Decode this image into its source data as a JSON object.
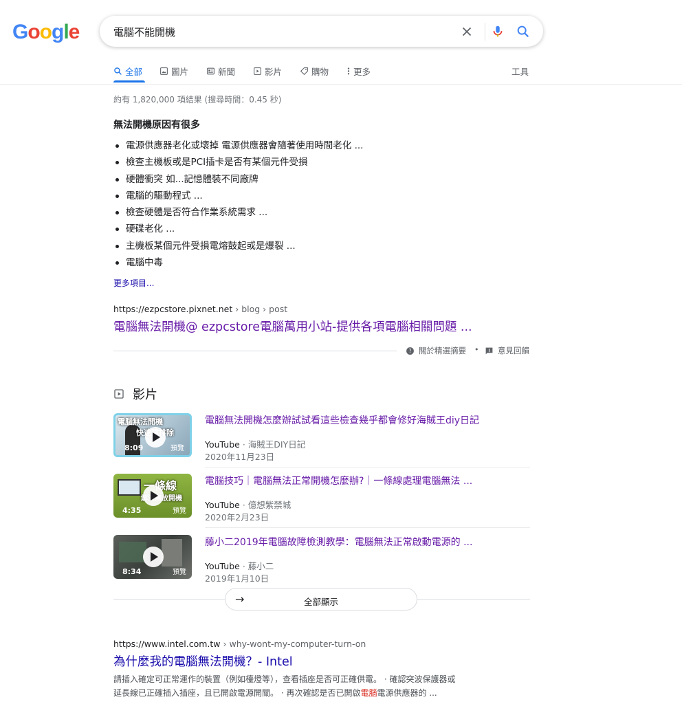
{
  "search": {
    "query": "電腦不能開機"
  },
  "tabs": [
    {
      "label": "全部",
      "icon": "search-icon"
    },
    {
      "label": "圖片",
      "icon": "image-icon"
    },
    {
      "label": "新聞",
      "icon": "news-icon"
    },
    {
      "label": "影片",
      "icon": "video-icon"
    },
    {
      "label": "購物",
      "icon": "tag-icon"
    },
    {
      "label": "更多",
      "icon": "more-vert-icon"
    }
  ],
  "tools_label": "工具",
  "result_stats": "約有 1,820,000 項結果 (搜尋時間：0.45 秒)",
  "featured_snippet": {
    "title": "無法開機原因有很多",
    "items": [
      "電源供應器老化或壞掉 電源供應器會隨著使用時間老化 ...",
      "檢查主機板或是PCI插卡是否有某個元件受損",
      "硬體衝突 如...記憶體裝不同廠牌",
      "電腦的驅動程式 ...",
      "檢查硬體是否符合作業系統需求 ...",
      "硬碟老化 ...",
      "主機板某個元件受損電熔鼓起或是爆裂 ...",
      "電腦中毒"
    ],
    "more_label": "更多項目...",
    "source_domain": "https://ezpcstore.pixnet.net",
    "source_path": " › blog › post",
    "source_title": "電腦無法開機@ ezpcstore電腦萬用小站-提供各項電腦相關問題 ...",
    "about_label": "關於精選摘要",
    "feedback_label": "意見回饋",
    "separator": "•"
  },
  "videos": {
    "header": "影片",
    "items": [
      {
        "title": "電腦無法開機怎麼辦試試看這些檢查幾乎都會修好海賊王diy日記",
        "source": "YouTube",
        "channel": " · 海賊王DIY日記",
        "date": "2020年11月23日",
        "duration": "8:09",
        "preview": "預覽",
        "thumb_text_1": "電腦無法開機",
        "thumb_text_2": "快速障排除"
      },
      {
        "title": "電腦技巧｜電腦無法正常開機怎麼辦?｜一條線處理電腦無法 ...",
        "source": "YouTube",
        "channel": " · 億想紫禁城",
        "date": "2020年2月23日",
        "duration": "4:35",
        "preview": "預覽",
        "thumb_text_1": "一條線",
        "thumb_text_2": "解決無故開機"
      },
      {
        "title": "藤小二2019年電腦故障檢測教學：電腦無法正常啟動電源的 ...",
        "source": "YouTube",
        "channel": " · 藤小二",
        "date": "2019年1月10日",
        "duration": "8:34",
        "preview": "預覽",
        "thumb_text_1": "",
        "thumb_text_2": ""
      }
    ],
    "show_all_label": "全部顯示"
  },
  "result2": {
    "domain": "https://www.intel.com.tw",
    "path": " › why-wont-my-computer-turn-on",
    "title": "為什麼我的電腦無法開機？- Intel",
    "desc_line1": "請插入確定可正常運作的裝置（例如檯燈等），查看插座是否可正確供電。 · 確認突波保護器或",
    "desc_line2_a": "延長線已正確插入插座，且已開啟電源開關。 · 再次確認是否已開啟",
    "desc_line2_em": "電腦",
    "desc_line2_b": "電源供應器的 ..."
  },
  "colors": {
    "link": "#1a0dab",
    "visited": "#681da8",
    "accent": "#1a73e8",
    "highlight": "#d93025"
  }
}
